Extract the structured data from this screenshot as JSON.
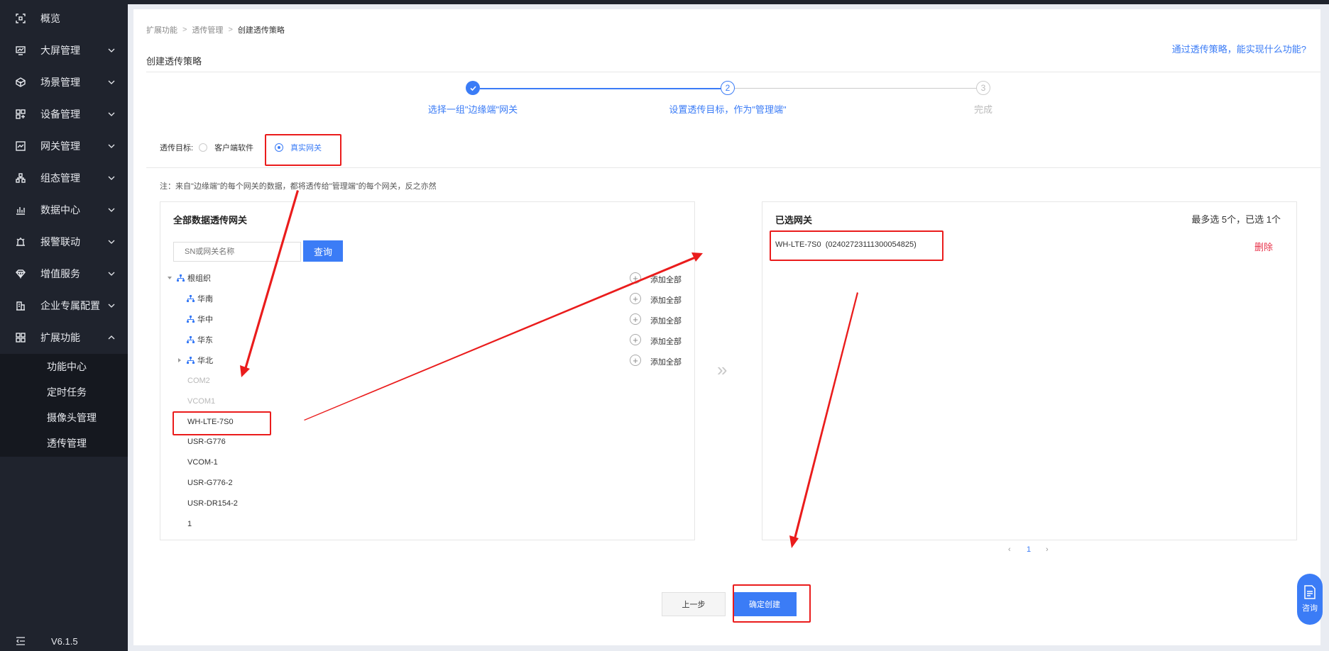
{
  "sidebar": {
    "items": [
      {
        "label": "概览",
        "icon": "overview-icon"
      },
      {
        "label": "大屏管理",
        "icon": "screen-icon"
      },
      {
        "label": "场景管理",
        "icon": "scene-icon"
      },
      {
        "label": "设备管理",
        "icon": "device-icon"
      },
      {
        "label": "网关管理",
        "icon": "gateway-icon"
      },
      {
        "label": "组态管理",
        "icon": "config-icon"
      },
      {
        "label": "数据中心",
        "icon": "data-center-icon"
      },
      {
        "label": "报警联动",
        "icon": "alarm-icon"
      },
      {
        "label": "增值服务",
        "icon": "diamond-icon"
      },
      {
        "label": "企业专属配置",
        "icon": "enterprise-icon"
      },
      {
        "label": "扩展功能",
        "icon": "extension-icon"
      }
    ],
    "submenu": [
      "功能中心",
      "定时任务",
      "摄像头管理",
      "透传管理"
    ],
    "version": "V6.1.5"
  },
  "breadcrumb": {
    "items": [
      "扩展功能",
      "透传管理",
      "创建透传策略"
    ]
  },
  "page": {
    "title": "创建透传策略",
    "help_link": "通过透传策略，能实现什么功能?"
  },
  "steps": [
    {
      "label": "选择一组\"边缘端\"网关",
      "num": "",
      "state": "done"
    },
    {
      "label": "设置透传目标，作为\"管理端\"",
      "num": "2",
      "state": "active"
    },
    {
      "label": "完成",
      "num": "3",
      "state": "pending"
    }
  ],
  "target": {
    "label": "透传目标:",
    "options": [
      "客户端软件",
      "真实网关"
    ],
    "selected": "真实网关"
  },
  "note": "注：来自\"边缘端\"的每个网关的数据，都将透传给\"管理端\"的每个网关，反之亦然",
  "left_panel": {
    "title": "全部数据透传网关",
    "search_placeholder": "SN或网关名称",
    "search_button": "查询",
    "tree": [
      {
        "name": "根组织",
        "add": "添加全部"
      },
      {
        "name": "华南",
        "add": "添加全部"
      },
      {
        "name": "华中",
        "add": "添加全部"
      },
      {
        "name": "华东",
        "add": "添加全部"
      },
      {
        "name": "华北",
        "add": "添加全部"
      }
    ],
    "devices": [
      {
        "name": "COM2",
        "disabled": true
      },
      {
        "name": "VCOM1",
        "disabled": true
      },
      {
        "name": "WH-LTE-7S0",
        "disabled": false
      },
      {
        "name": "USR-G776",
        "disabled": false
      },
      {
        "name": "VCOM-1",
        "disabled": false
      },
      {
        "name": "USR-G776-2",
        "disabled": false
      },
      {
        "name": "USR-DR154-2",
        "disabled": false
      },
      {
        "name": "1",
        "disabled": false
      }
    ]
  },
  "right_panel": {
    "title": "已选网关",
    "count_text": "最多选 5个，已选 1个",
    "selected": [
      {
        "name": "WH-LTE-7S0",
        "sn": "(02402723111300054825)"
      }
    ],
    "delete_label": "删除",
    "page": "1"
  },
  "footer": {
    "prev_label": "上一步",
    "create_label": "确定创建"
  },
  "consult_label": "咨询",
  "colors": {
    "accent": "#3b7cf6",
    "sidebar": "#1f232d",
    "annotation": "#ea1c1c",
    "delete": "#e8334a"
  }
}
